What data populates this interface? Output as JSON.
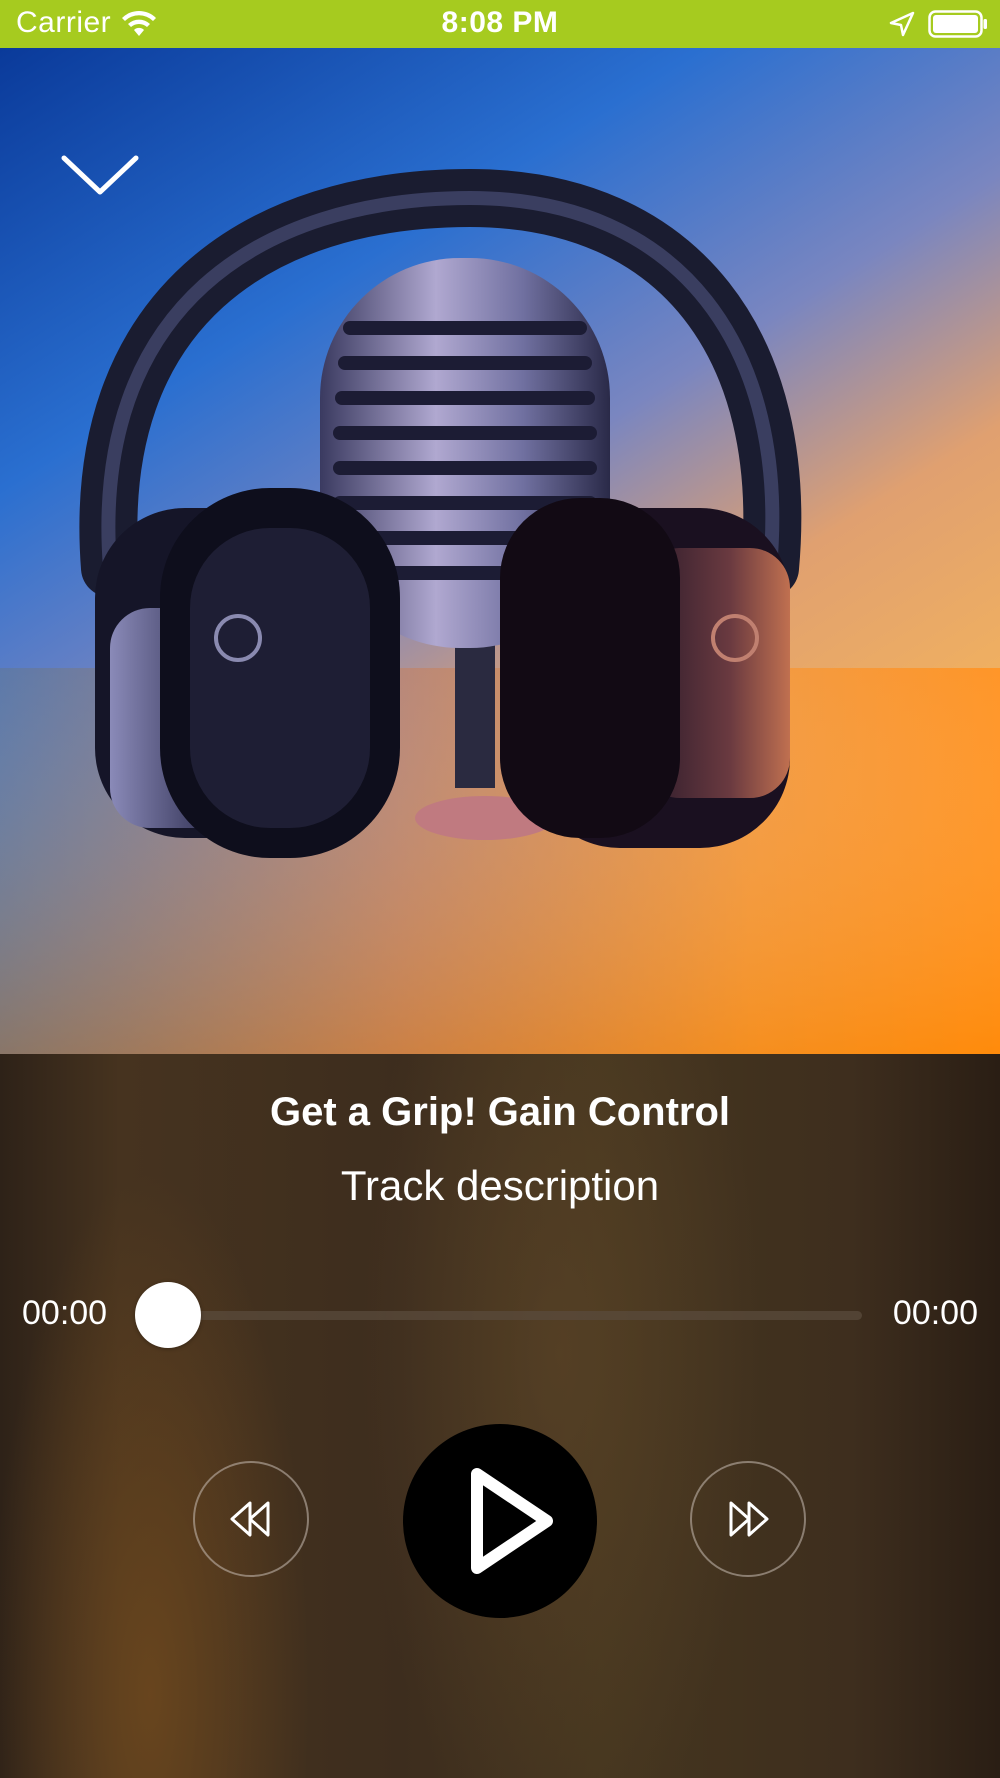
{
  "status_bar": {
    "carrier": "Carrier",
    "time": "8:08 PM",
    "background_color": "#a6cb1f",
    "icons": [
      "wifi-icon",
      "location-arrow-icon",
      "battery-icon"
    ]
  },
  "artwork": {
    "icon": "chevron-down-icon",
    "description_icon": "headphones-microphone-artwork"
  },
  "track": {
    "title": "Get a Grip! Gain Control",
    "description": "Track description"
  },
  "progress": {
    "elapsed": "00:00",
    "total": "00:00",
    "fraction": 0
  },
  "controls": {
    "rewind_icon": "rewind-icon",
    "play_icon": "play-icon",
    "forward_icon": "fast-forward-icon"
  }
}
